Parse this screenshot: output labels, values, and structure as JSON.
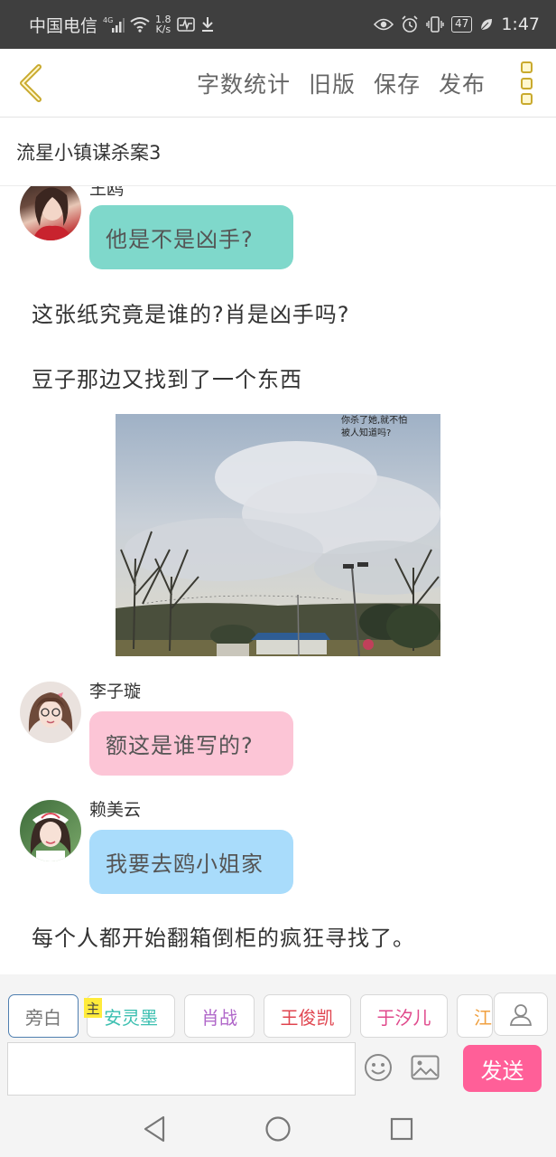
{
  "status_bar": {
    "carrier": "中国电信",
    "network": "4G",
    "speed_value": "1.8",
    "speed_unit": "K/s",
    "battery": "47",
    "time": "1:47"
  },
  "toolbar": {
    "word_count": "字数统计",
    "old_version": "旧版",
    "save": "保存",
    "publish": "发布"
  },
  "story": {
    "title": "流星小镇谋杀案3"
  },
  "messages": [
    {
      "sender": "王鸥",
      "text": "他是不是凶手?",
      "bubble_color": "#7fd8cb"
    },
    {
      "narration": "这张纸究竟是谁的?肖是凶手吗?"
    },
    {
      "narration": "豆子那边又找到了一个东西"
    },
    {
      "image_caption_line1": "你杀了她,就不怕",
      "image_caption_line2": "被人知道吗?"
    },
    {
      "sender": "李子璇",
      "text": "额这是谁写的?",
      "bubble_color": "#fcc5d6"
    },
    {
      "sender": "赖美云",
      "text": "我要去鸥小姐家",
      "bubble_color": "#a9dcfb"
    },
    {
      "narration": "每个人都开始翻箱倒柜的疯狂寻找了。"
    }
  ],
  "characters": [
    {
      "label": "旁白",
      "color": "#777777",
      "active": true
    },
    {
      "label": "安灵墨",
      "color": "#3bbfb0",
      "badge": "主"
    },
    {
      "label": "肖战",
      "color": "#b067c9"
    },
    {
      "label": "王俊凯",
      "color": "#e0454f"
    },
    {
      "label": "于汐儿",
      "color": "#e04a8c"
    },
    {
      "label": "江",
      "color": "#f0a040"
    }
  ],
  "composer": {
    "input_placeholder": "",
    "send_label": "发送"
  },
  "icons": {
    "back": "chevron-left-icon",
    "more": "more-vertical-icon",
    "user": "user-icon",
    "emoji": "emoji-icon",
    "image": "image-icon",
    "nav_back": "triangle-back-icon",
    "nav_home": "circle-home-icon",
    "nav_recent": "square-recent-icon"
  }
}
